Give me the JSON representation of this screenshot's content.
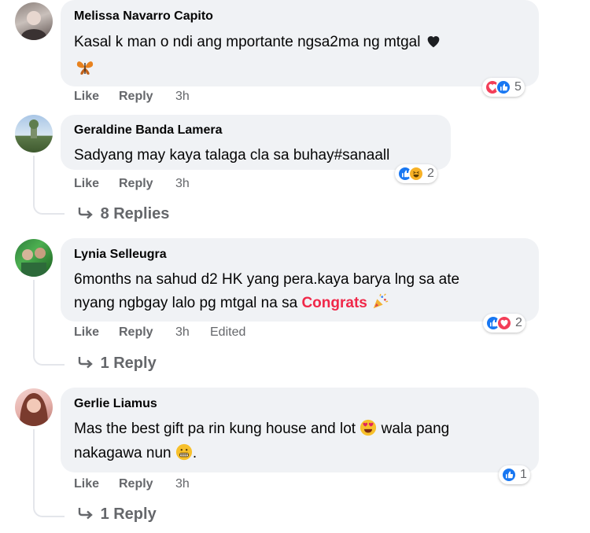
{
  "comments": [
    {
      "author": "Melissa Navarro Capito",
      "text_line1": "Kasal k man o ndi ang mportante ngsa2ma ng mtgal",
      "like": "Like",
      "reply": "Reply",
      "time": "3h",
      "reaction_count": "5",
      "reaction_icons": [
        "love-reaction-icon",
        "like-reaction-icon"
      ],
      "emoji": [
        "black-heart-emoji",
        "butterfly-emoji"
      ]
    },
    {
      "author": "Geraldine Banda Lamera",
      "text_line1": "Sadyang may kaya talaga cla sa buhay#sanaall",
      "like": "Like",
      "reply": "Reply",
      "time": "3h",
      "reaction_count": "2",
      "reaction_icons": [
        "like-reaction-icon",
        "haha-reaction-icon"
      ],
      "replies_label": "8 Replies"
    },
    {
      "author": "Lynia Selleugra",
      "text_line1": "6months na sahud d2 HK yang pera.kaya barya lng sa ate",
      "text_line2": "nyang ngbgay lalo pg mtgal na sa",
      "highlight": "Congrats",
      "like": "Like",
      "reply": "Reply",
      "time": "3h",
      "edited": "Edited",
      "reaction_count": "2",
      "reaction_icons": [
        "like-reaction-icon",
        "love-reaction-icon"
      ],
      "emoji": [
        "party-popper-emoji"
      ],
      "replies_label": "1 Reply"
    },
    {
      "author": "Gerlie Liamus",
      "text_line1": "Mas the best gift pa rin kung house and lot",
      "text_line1_after": "wala pang",
      "text_line2": "nakagawa nun",
      "text_line2_after": ".",
      "like": "Like",
      "reply": "Reply",
      "time": "3h",
      "reaction_count": "1",
      "reaction_icons": [
        "like-reaction-icon"
      ],
      "emoji": [
        "heart-eyes-emoji",
        "grimace-emoji"
      ],
      "replies_label": "1 Reply"
    }
  ],
  "colors": {
    "bubble": "#f0f2f5",
    "meta": "#65676b",
    "like_blue": "#1877f2",
    "love_red": "#f33e58",
    "highlight": "#f02849"
  }
}
